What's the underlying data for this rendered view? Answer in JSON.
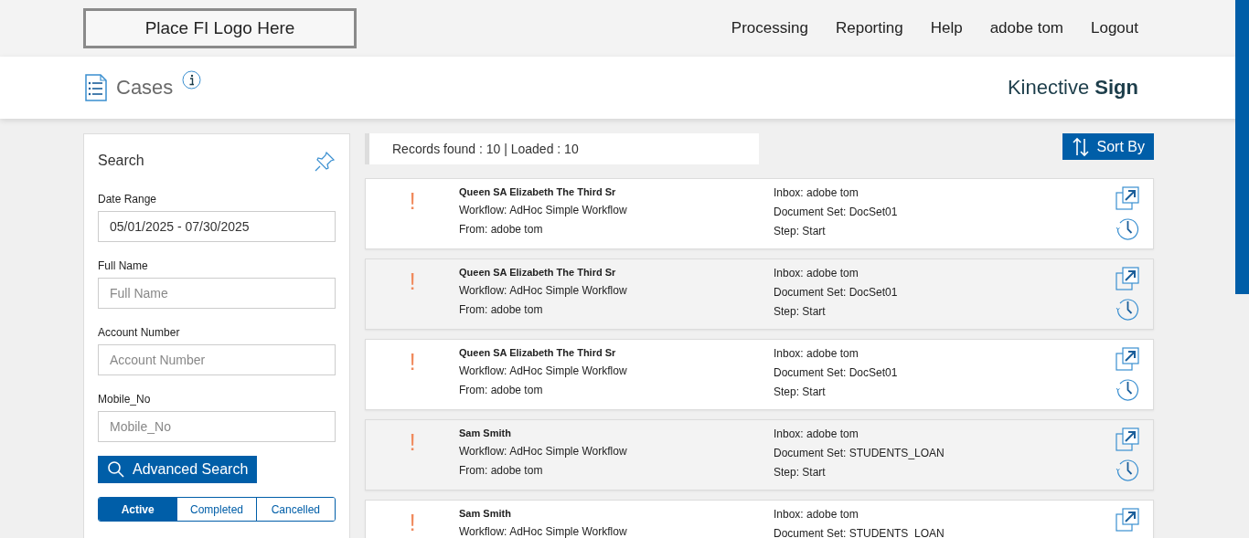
{
  "header": {
    "logo": "Place FI Logo Here",
    "nav": [
      "Processing",
      "Reporting",
      "Help",
      "adobe tom",
      "Logout"
    ]
  },
  "title_bar": {
    "title": "Cases",
    "brand": "Kinective ",
    "brand_bold": "Sign"
  },
  "search": {
    "title": "Search",
    "fields": [
      {
        "label": "Date Range",
        "value": "05/01/2025 - 07/30/2025"
      },
      {
        "label": "Full Name",
        "placeholder": "Full Name"
      },
      {
        "label": "Account Number",
        "placeholder": "Account Number"
      },
      {
        "label": "Mobile_No",
        "placeholder": "Mobile_No"
      }
    ],
    "advanced_button": "Advanced Search",
    "status_tabs": [
      {
        "label": "Active",
        "selected": true
      },
      {
        "label": "Completed",
        "selected": false
      },
      {
        "label": "Cancelled",
        "selected": false
      }
    ]
  },
  "records": {
    "summary": "Records found : 10 | Loaded : 10",
    "sort_button": "Sort By"
  },
  "cases": [
    {
      "alert": "!",
      "name": "Queen SA Elizabeth The Third Sr",
      "workflow": "Workflow: AdHoc Simple Workflow",
      "from": "From: adobe tom",
      "inbox": "Inbox: adobe tom",
      "document_set": "Document Set: DocSet01",
      "step": "Step: Start"
    },
    {
      "alert": "!",
      "name": "Queen SA Elizabeth The Third Sr",
      "workflow": "Workflow: AdHoc Simple Workflow",
      "from": "From: adobe tom",
      "inbox": "Inbox: adobe tom",
      "document_set": "Document Set: DocSet01",
      "step": "Step: Start"
    },
    {
      "alert": "!",
      "name": "Queen SA Elizabeth The Third Sr",
      "workflow": "Workflow: AdHoc Simple Workflow",
      "from": "From: adobe tom",
      "inbox": "Inbox: adobe tom",
      "document_set": "Document Set: DocSet01",
      "step": "Step: Start"
    },
    {
      "alert": "!",
      "name": "Sam Smith",
      "workflow": "Workflow: AdHoc Simple Workflow",
      "from": "From: adobe tom",
      "inbox": "Inbox: adobe tom",
      "document_set": "Document Set: STUDENTS_LOAN",
      "step": "Step: Start"
    },
    {
      "alert": "!",
      "name": "Sam Smith",
      "workflow": "Workflow: AdHoc Simple Workflow",
      "inbox": "Inbox: adobe tom",
      "document_set": "Document Set: STUDENTS_LOAN"
    }
  ]
}
